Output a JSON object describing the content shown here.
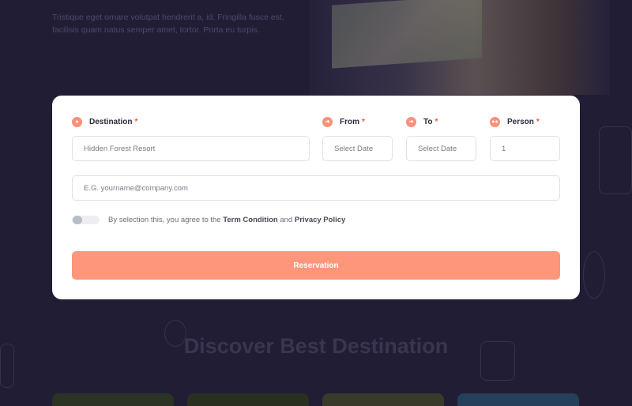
{
  "hero": {
    "text": "Tristique eget ornare volutpat hendrerit a, id. Fringilla fusce est, facilisis quam natus semper amet, tortor. Porta eu turpis."
  },
  "form": {
    "destination": {
      "label": "Destination",
      "required": "*",
      "value": "Hidden Forest Resort",
      "icon": "map-pin-icon"
    },
    "from": {
      "label": "From",
      "required": "*",
      "placeholder": "Select Date",
      "icon": "sign-in-icon"
    },
    "to": {
      "label": "To",
      "required": "*",
      "placeholder": "Select Date",
      "icon": "sign-out-icon"
    },
    "person": {
      "label": "Person",
      "required": "*",
      "value": "1",
      "icon": "users-icon"
    },
    "email": {
      "placeholder": "E.G. yourname@company.com"
    },
    "agreement": {
      "prefix": "By selection this, you agree to the",
      "term": "Term Condition",
      "and": "and",
      "privacy": "Privacy Policy"
    },
    "submit_label": "Reservation"
  },
  "section": {
    "title": "Discover Best Destination"
  },
  "colors": {
    "background": "#211d35",
    "accent": "#fe967c",
    "required": "#f0573d"
  }
}
